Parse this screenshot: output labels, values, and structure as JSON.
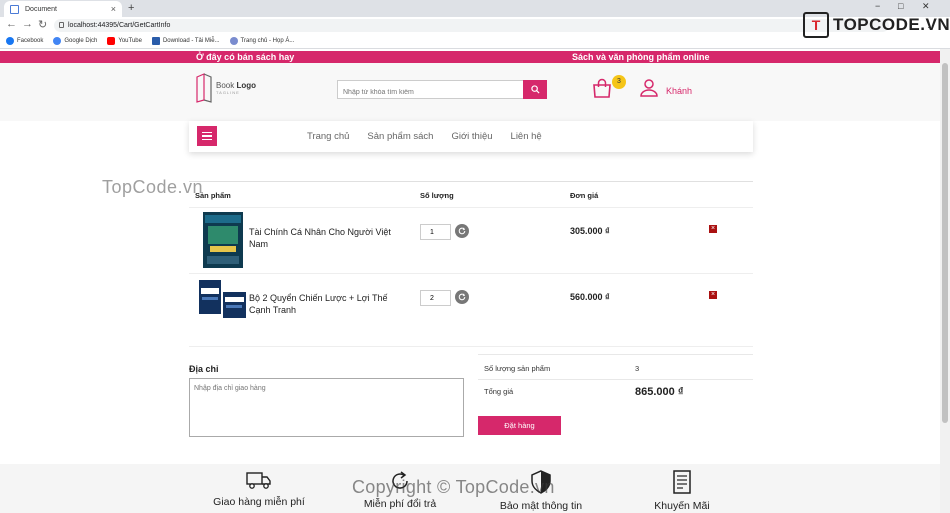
{
  "browser": {
    "tab_title": "Document",
    "tab_close": "×",
    "new_tab": "+",
    "url": "localhost:44395/Cart/GetCartInfo",
    "bookmarks": [
      {
        "label": "Facebook",
        "color": "#1877f2"
      },
      {
        "label": "Google Dịch",
        "color": "#4285f4"
      },
      {
        "label": "YouTube",
        "color": "#ff0000"
      },
      {
        "label": "Download - Tải Miễ...",
        "color": "#2a5caa"
      },
      {
        "label": "Trang chủ - Họp Á...",
        "color": "#7a8ccf"
      }
    ],
    "icons": {
      "back": "←",
      "forward": "→",
      "reload": "↻",
      "star": "☆",
      "menu": "⋮",
      "minimize": "−",
      "maximize": "□",
      "close": "✕"
    }
  },
  "watermark": {
    "logo_box": "T",
    "logo_text": "TOPCODE.VN",
    "mid_text": "TopCode.vn",
    "bottom_text": "Copyright © TopCode.vn"
  },
  "promo": {
    "left": "Ở đây có bán sách hay",
    "right": "Sách và văn phòng phẩm online"
  },
  "header": {
    "logo_text_1": "Book",
    "logo_text_2": "Logo",
    "logo_tagline": "TAGLINE",
    "search_placeholder": "Nhập từ khóa tìm kiếm",
    "cart_count": "3",
    "user_name": "Khánh"
  },
  "nav": {
    "items": [
      "Trang chủ",
      "Sản phẩm sách",
      "Giới thiệu",
      "Liên hệ"
    ]
  },
  "cart": {
    "headers": {
      "product": "Sản phẩm",
      "quantity": "Số lượng",
      "price": "Đơn giá"
    },
    "items": [
      {
        "name": "Tài Chính Cá Nhân Cho Người Việt Nam",
        "quantity": "1",
        "price": "305.000 ₫"
      },
      {
        "name": "Bộ 2 Quyển Chiến Lược + Lợi Thế Cạnh Tranh",
        "quantity": "2",
        "price": "560.000 ₫"
      }
    ],
    "address_label": "Địa chỉ",
    "address_placeholder": "Nhập địa chỉ giao hàng",
    "summary": {
      "count_label": "Số lượng sản phẩm",
      "count_value": "3",
      "total_label": "Tổng giá",
      "total_value": "865.000 ₫"
    },
    "order_button": "Đặt hàng"
  },
  "features": [
    {
      "label": "Giao hàng miễn phí",
      "icon": "truck-icon"
    },
    {
      "label": "Miễn phí đổi trả",
      "icon": "refresh-icon"
    },
    {
      "label": "Bảo mật thông tin",
      "icon": "shield-icon"
    },
    {
      "label": "Khuyến Mãi",
      "icon": "receipt-icon"
    }
  ],
  "colors": {
    "accent": "#d6286b",
    "badge": "#f5c518"
  }
}
